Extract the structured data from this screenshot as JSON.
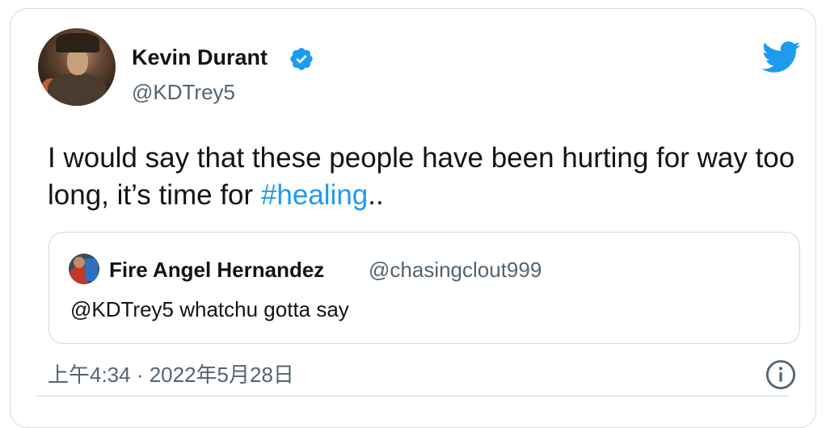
{
  "author": {
    "name": "Kevin Durant",
    "handle": "@KDTrey5",
    "verified": true
  },
  "tweet": {
    "text_before": "I would say that these people have been hurting for way too long, it’s time for ",
    "hashtag": "#healing",
    "text_after": ".."
  },
  "quoted_tweet": {
    "name": "Fire Angel Hernandez",
    "handle": "@chasingclout999",
    "text": "@KDTrey5 whatchu gotta say"
  },
  "timestamp": "上午4:34 · 2022年5月28日",
  "colors": {
    "accent": "#1d9bf0",
    "text": "#0f1419",
    "secondary": "#536471",
    "border": "#cfd9de"
  },
  "icons": {
    "verified": "verified-badge-icon",
    "brand": "twitter-bird-icon",
    "info": "info-icon"
  }
}
